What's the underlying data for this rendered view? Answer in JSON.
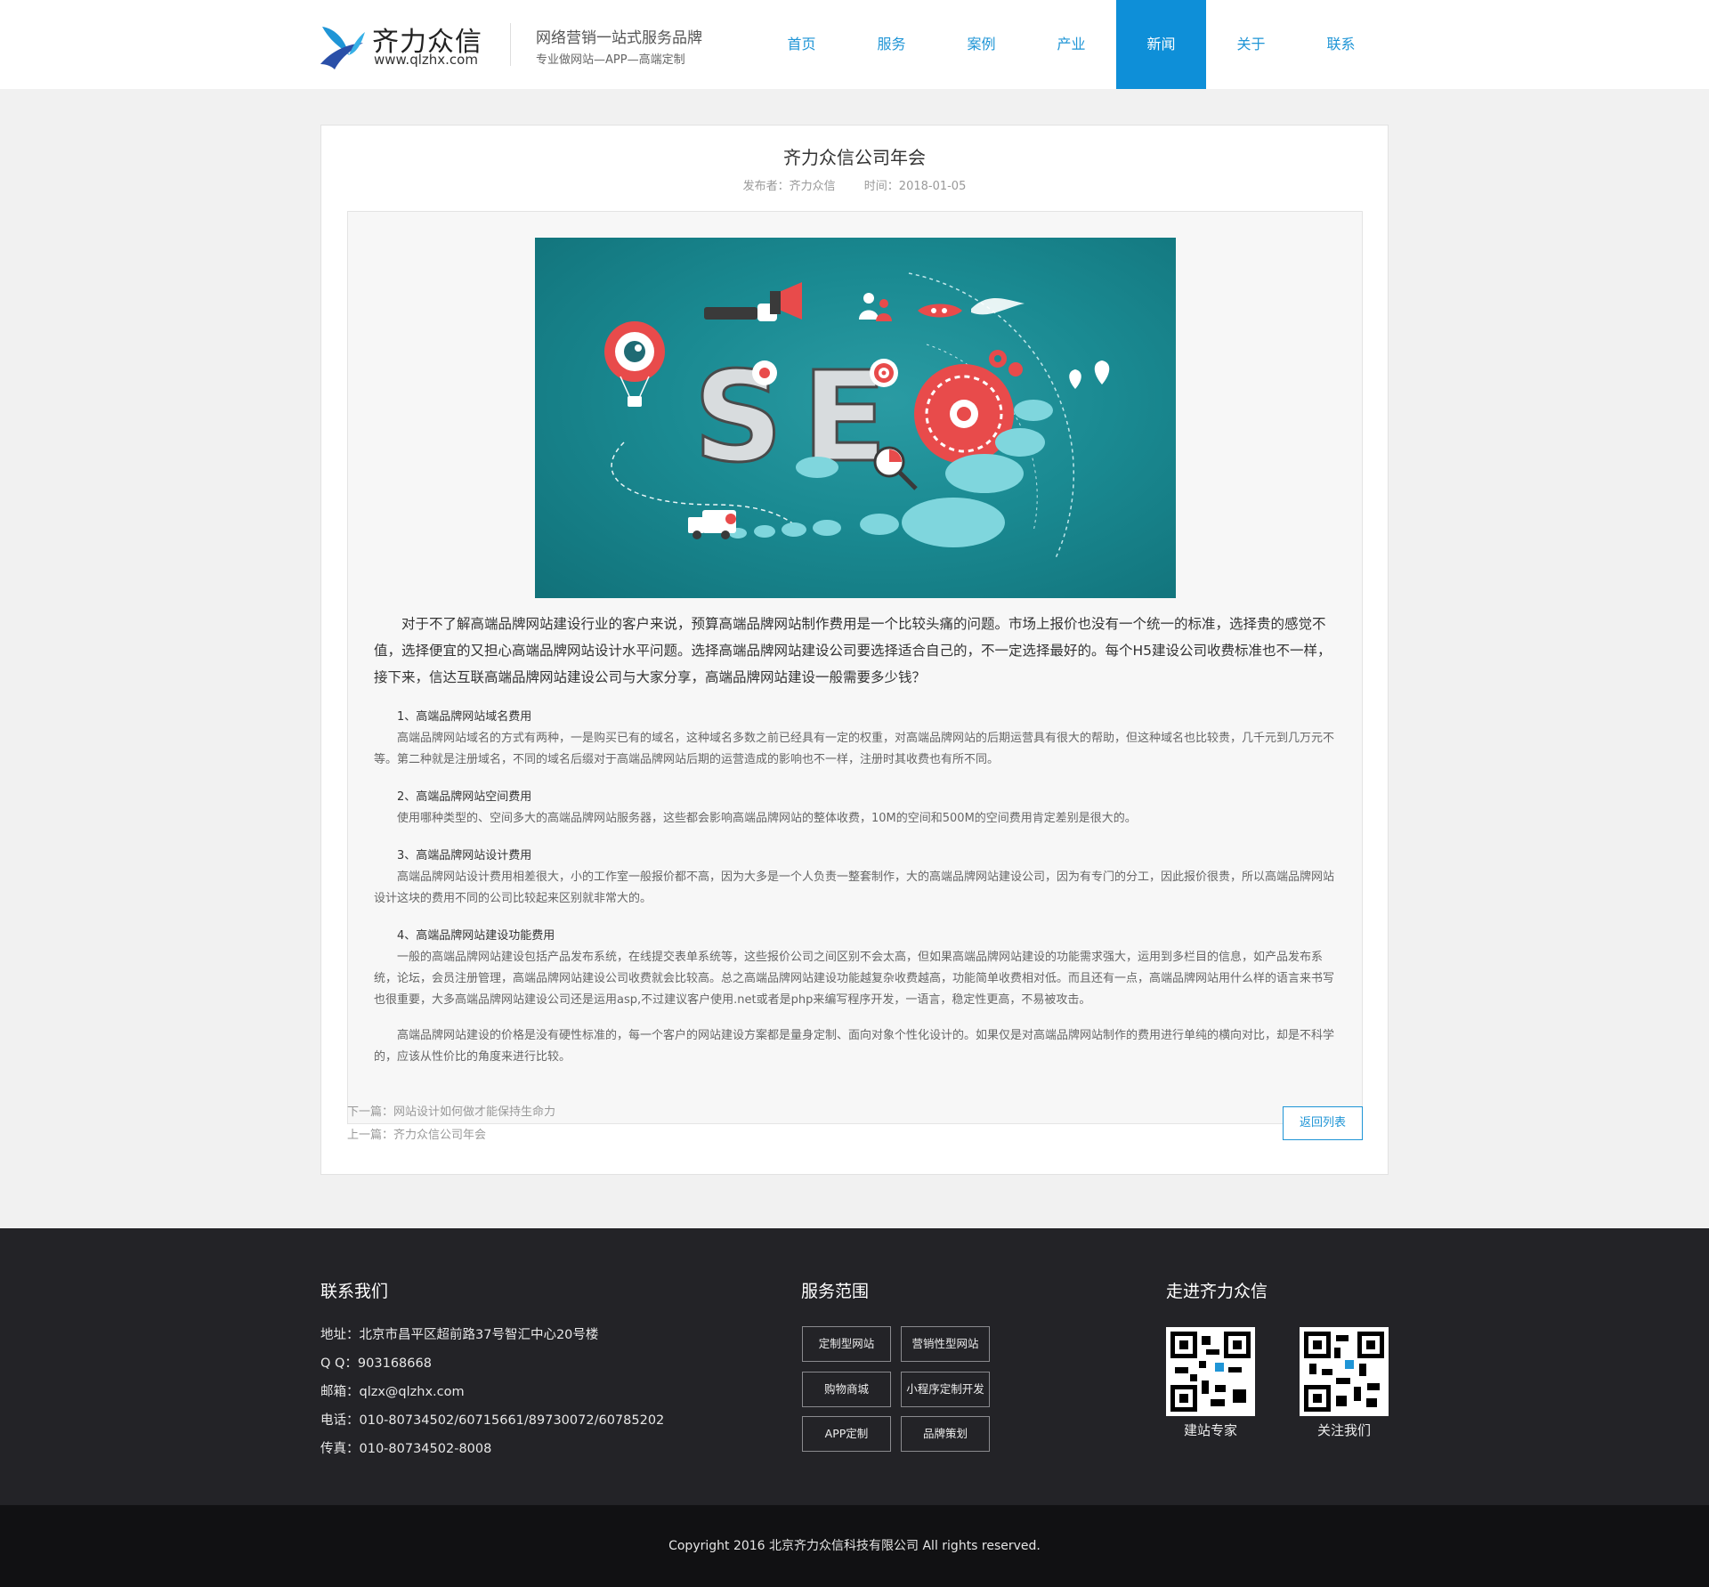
{
  "header": {
    "logo_cn": "齐力众信",
    "logo_en": "www.qlzhx.com",
    "slogan_main": "网络营销一站式服务品牌",
    "slogan_sub": "专业做网站—APP—高端定制",
    "nav": [
      "首页",
      "服务",
      "案例",
      "产业",
      "新闻",
      "关于",
      "联系"
    ],
    "active_nav": "新闻",
    "accent_color": "#0e8fd8"
  },
  "article": {
    "title": "齐力众信公司年会",
    "publisher_label": "发布者：齐力众信",
    "time_label": "时间：2018-01-05",
    "hero_text": "SE",
    "intro": "对于不了解高端品牌网站建设行业的客户来说，预算高端品牌网站制作费用是一个比较头痛的问题。市场上报价也没有一个统一的标准，选择贵的感觉不值，选择便宜的又担心高端品牌网站设计水平问题。选择高端品牌网站建设公司要选择适合自己的，不一定选择最好的。每个H5建设公司收费标准也不一样，接下来，信达互联高端品牌网站建设公司与大家分享，高端品牌网站建设一般需要多少钱？",
    "sections": [
      {
        "heading": "1、高端品牌网站域名费用",
        "body": "高端品牌网站域名的方式有两种，一是购买已有的域名，这种域名多数之前已经具有一定的权重，对高端品牌网站的后期运营具有很大的帮助，但这种域名也比较贵，几千元到几万元不等。第二种就是注册域名，不同的域名后缀对于高端品牌网站后期的运营造成的影响也不一样，注册时其收费也有所不同。"
      },
      {
        "heading": "2、高端品牌网站空间费用",
        "body": "使用哪种类型的、空间多大的高端品牌网站服务器，这些都会影响高端品牌网站的整体收费，10M的空间和500M的空间费用肯定差别是很大的。"
      },
      {
        "heading": "3、高端品牌网站设计费用",
        "body": "高端品牌网站设计费用相差很大，小的工作室一般报价都不高，因为大多是一个人负责一整套制作，大的高端品牌网站建设公司，因为有专门的分工，因此报价很贵，所以高端品牌网站设计这块的费用不同的公司比较起来区别就非常大的。"
      },
      {
        "heading": "4、高端品牌网站建设功能费用",
        "body": "一般的高端品牌网站建设包括产品发布系统，在线提交表单系统等，这些报价公司之间区别不会太高，但如果高端品牌网站建设的功能需求强大，运用到多栏目的信息，如产品发布系统，论坛，会员注册管理，高端品牌网站建设公司收费就会比较高。总之高端品牌网站建设功能越复杂收费越高，功能简单收费相对低。而且还有一点，高端品牌网站用什么样的语言来书写也很重要，大多高端品牌网站建设公司还是运用asp,不过建议客户使用.net或者是php来编写程序开发，一语言，稳定性更高，不易被攻击。"
      }
    ],
    "closing": "高端品牌网站建设的价格是没有硬性标准的，每一个客户的网站建设方案都是量身定制、面向对象个性化设计的。如果仅是对高端品牌网站制作的费用进行单纯的横向对比，却是不科学的，应该从性价比的角度来进行比较。",
    "next_label": "下一篇：",
    "next_title": "网站设计如何做才能保持生命力",
    "prev_label": "上一篇：",
    "prev_title": "齐力众信公司年会",
    "back_button": "返回列表"
  },
  "footer": {
    "contact_heading": "联系我们",
    "contact_lines": [
      "地址：北京市昌平区超前路37号智汇中心20号楼",
      "Q Q：903168668",
      "邮箱：qlzx@qlzhx.com",
      "电话：010-80734502/60715661/89730072/60785202",
      "传真：010-80734502-8008"
    ],
    "services_heading": "服务范围",
    "services": [
      "定制型网站",
      "营销性型网站",
      "购物商城",
      "小程序定制开发",
      "APP定制",
      "品牌策划"
    ],
    "about_heading": "走进齐力众信",
    "qr_labels": [
      "建站专家",
      "关注我们"
    ],
    "copyright": "Copyright 2016 北京齐力众信科技有限公司 All rights reserved."
  }
}
